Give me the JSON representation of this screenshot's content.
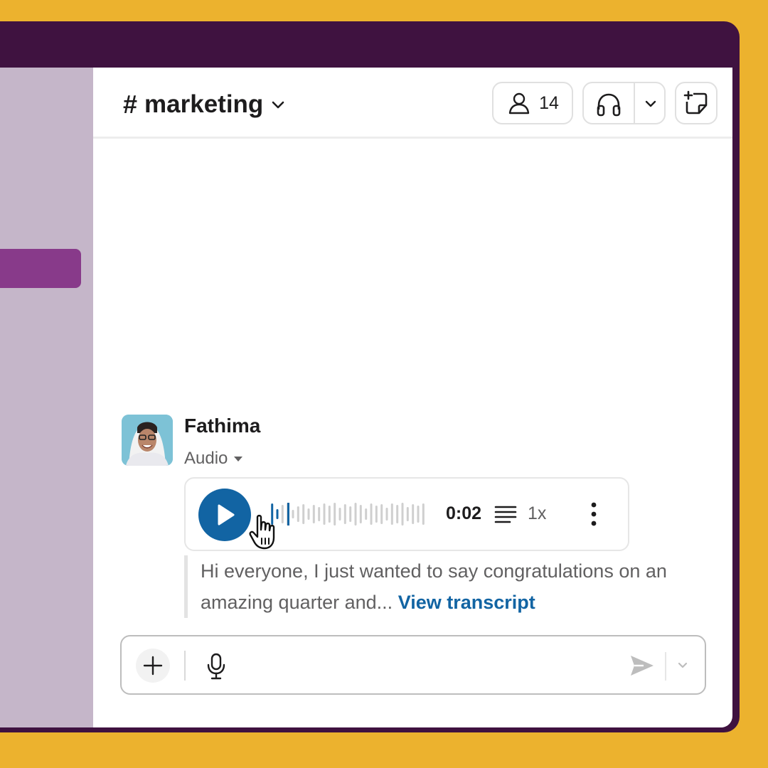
{
  "channel": {
    "hash": "#",
    "name": "marketing",
    "member_count": "14"
  },
  "message": {
    "author": "Fathima",
    "type_label": "Audio",
    "audio": {
      "duration": "0:02",
      "speed": "1x",
      "progress": 0.05
    },
    "transcript_preview": "Hi everyone, I just wanted to say congratulations on an amazing quarter and...",
    "view_transcript_label": "View transcript"
  },
  "colors": {
    "background": "#ECB22E",
    "frame": "#3F1240",
    "sidebar": "#C5B6C9",
    "sidebar_active": "#883A8A",
    "accent": "#1264A3"
  },
  "icons": {
    "members": "person-icon",
    "huddle": "headphones-icon",
    "canvas": "new-canvas-icon",
    "play": "play-icon",
    "transcript": "transcript-lines-icon",
    "more": "vertical-dots-icon",
    "add": "plus-icon",
    "mic": "microphone-icon",
    "send": "send-icon"
  }
}
